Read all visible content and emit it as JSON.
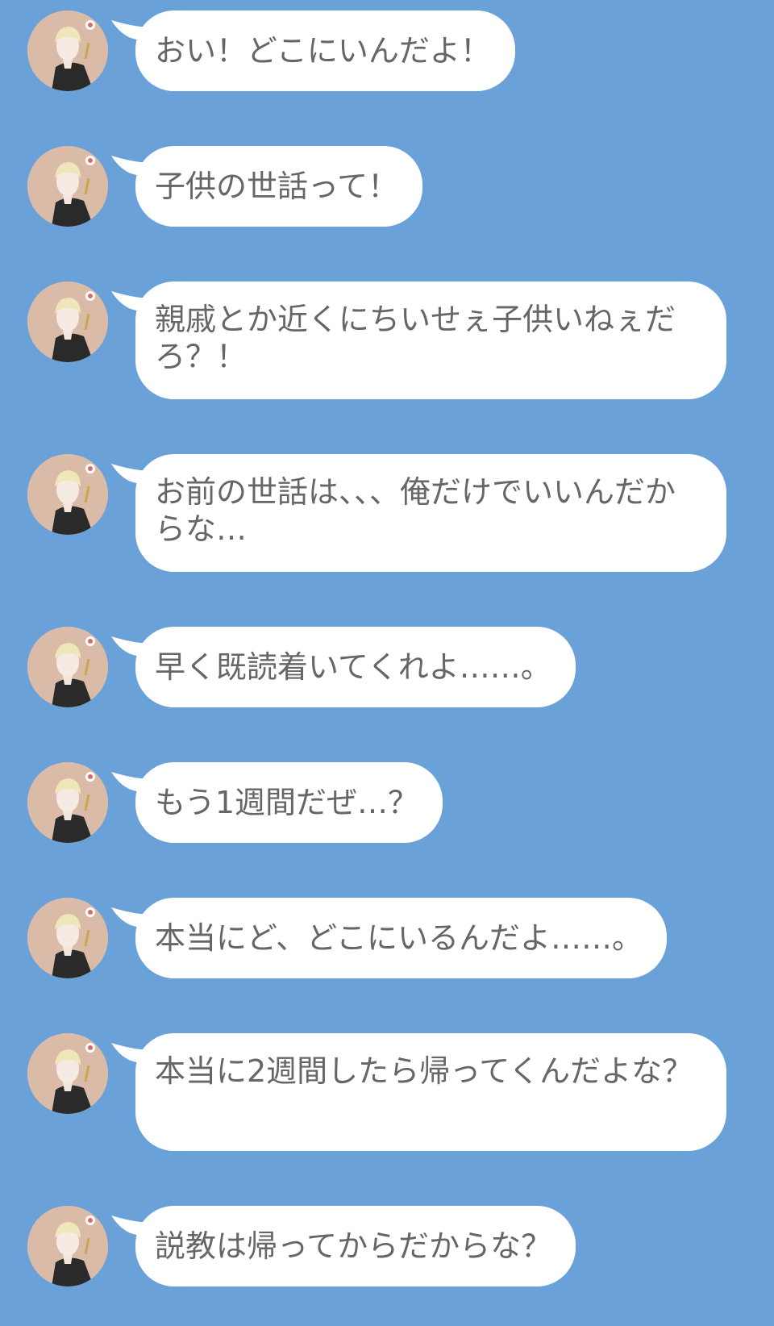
{
  "chat": {
    "messages": [
      {
        "text": "おい！どこにいんだよ！"
      },
      {
        "text": "子供の世話って！"
      },
      {
        "text": "親戚とか近くにちいせぇ子供いねぇだろ？！"
      },
      {
        "text": "お前の世話は、、、俺だけでいいんだからな…"
      },
      {
        "text": "早く既読着いてくれよ……。"
      },
      {
        "text": "もう1週間だぜ…？"
      },
      {
        "text": "本当にど、どこにいるんだよ……。"
      },
      {
        "text": "本当に2週間したら帰ってくんだよな？"
      },
      {
        "text": "説教は帰ってからだからな？"
      }
    ]
  },
  "avatar": {
    "icon": "user-avatar-icon",
    "background_color": "#d9bba8",
    "hair_color": "#efe7b9",
    "clothing_color": "#2a2a2a"
  },
  "colors": {
    "background": "#6aa1d8",
    "bubble": "#ffffff",
    "text": "#666666"
  }
}
